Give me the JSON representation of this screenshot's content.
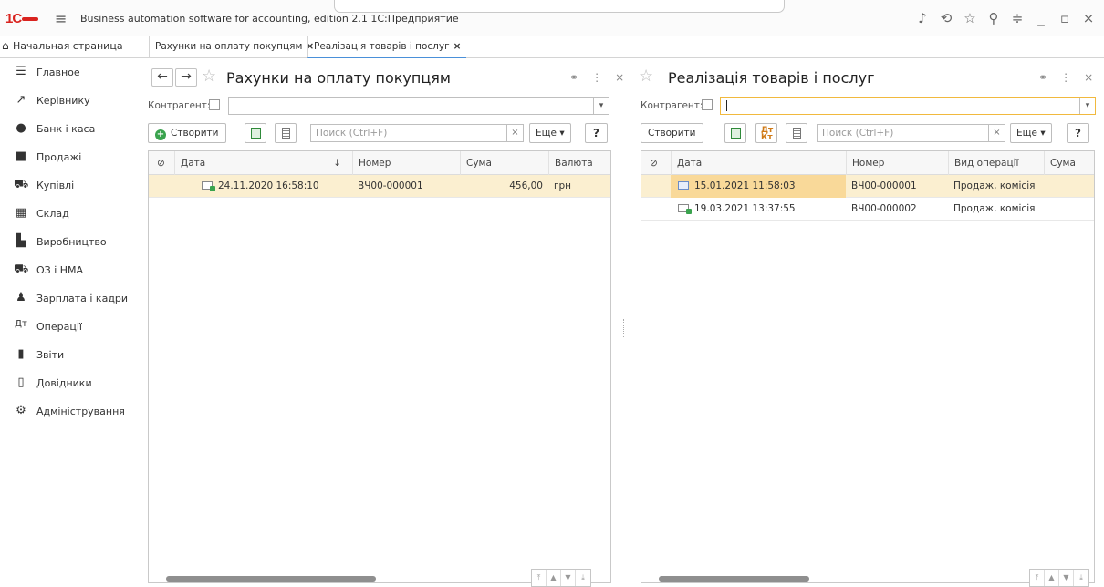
{
  "app": {
    "logo": "1С",
    "title": "Business automation software for accounting, edition 2.1 1С:Предприятие",
    "window_icons": [
      "bell-icon",
      "history-icon",
      "star-icon",
      "search-icon",
      "settings-icon",
      "minimize-icon",
      "maximize-icon",
      "close-icon"
    ]
  },
  "tabs": {
    "home": "Начальная страница",
    "items": [
      {
        "label": "Рахунки на оплату покупцям",
        "close": "×"
      },
      {
        "label": "Реалізація товарів і послуг",
        "close": "×"
      }
    ]
  },
  "sidebar": {
    "items": [
      {
        "label": "Главное",
        "icon": "menu-icon"
      },
      {
        "label": "Керівнику",
        "icon": "trend-icon"
      },
      {
        "label": "Банк і каса",
        "icon": "bank-icon"
      },
      {
        "label": "Продажі",
        "icon": "bag-icon"
      },
      {
        "label": "Купівлі",
        "icon": "cart-icon"
      },
      {
        "label": "Склад",
        "icon": "warehouse-icon"
      },
      {
        "label": "Виробництво",
        "icon": "factory-icon"
      },
      {
        "label": "ОЗ і НМА",
        "icon": "truck-icon"
      },
      {
        "label": "Зарплата і кадри",
        "icon": "person-icon"
      },
      {
        "label": "Операції",
        "icon": "operations-icon"
      },
      {
        "label": "Звіти",
        "icon": "chart-icon"
      },
      {
        "label": "Довідники",
        "icon": "book-icon"
      },
      {
        "label": "Адміністрування",
        "icon": "gear-icon"
      }
    ]
  },
  "left_panel": {
    "title": "Рахунки на оплату покупцям",
    "back": "←",
    "forward": "→",
    "counterparty_label": "Контрагент:",
    "counterparty_value": "",
    "create_label": "Створити",
    "search_placeholder": "Поиск (Ctrl+F)",
    "clear": "×",
    "more_label": "Еще ▾",
    "help": "?",
    "columns": [
      "Дата",
      "↓",
      "Номер",
      "Сума",
      "Валюта"
    ],
    "rows": [
      {
        "date": "24.11.2020 16:58:10",
        "number": "ВЧ00-000001",
        "sum": "456,00",
        "currency": "грн"
      }
    ]
  },
  "right_panel": {
    "title": "Реалізація товарів і послуг",
    "counterparty_label": "Контрагент:",
    "counterparty_value": "",
    "create_label": "Створити",
    "search_placeholder": "Поиск (Ctrl+F)",
    "clear": "×",
    "more_label": "Еще ▾",
    "help": "?",
    "dtkt": "Дт Кт",
    "columns": [
      "Дата",
      "Номер",
      "Вид операції",
      "Сума"
    ],
    "rows": [
      {
        "date": "15.01.2021 11:58:03",
        "number": "ВЧ00-000001",
        "op": "Продаж, комісія",
        "sum": ""
      },
      {
        "date": "19.03.2021 13:37:55",
        "number": "ВЧ00-000002",
        "op": "Продаж, комісія",
        "sum": ""
      }
    ]
  },
  "colors": {
    "accent_orange": "#f1b93e",
    "selected_row": "#fbefd0",
    "logo_red": "#d9231f",
    "create_green": "#3aa34e"
  }
}
